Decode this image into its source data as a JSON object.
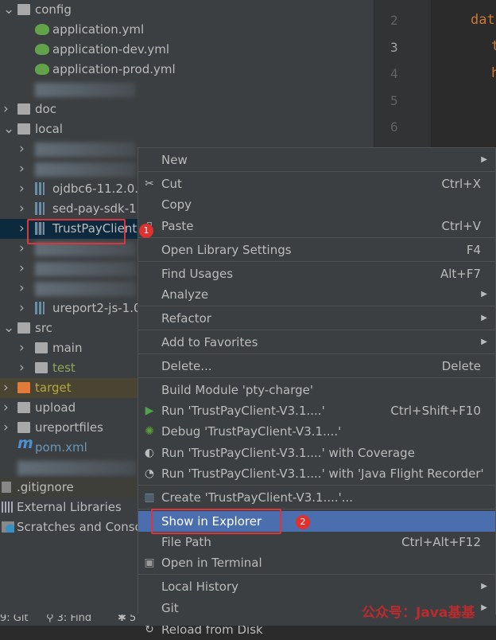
{
  "tree": [
    {
      "label": "config",
      "chevron": "down",
      "icon": "folder-config-icon",
      "level": 0
    },
    {
      "label": "application.yml",
      "icon": "spring-yml-icon",
      "level": 1
    },
    {
      "label": "application-dev.yml",
      "icon": "spring-yml-icon",
      "level": 1
    },
    {
      "label": "application-prod.yml",
      "icon": "spring-yml-icon",
      "level": 1
    },
    {
      "label": "",
      "blurred": true,
      "level": 1
    },
    {
      "label": "doc",
      "chevron": "right",
      "icon": "folder-icon",
      "level": 0
    },
    {
      "label": "local",
      "chevron": "down",
      "icon": "folder-icon",
      "level": 0
    },
    {
      "label": "",
      "blurred": true,
      "chevron": "right",
      "level": 2
    },
    {
      "label": "",
      "blurred": true,
      "chevron": "right",
      "level": 2
    },
    {
      "label": "ojdbc6-11.2.0.",
      "chevron": "right",
      "icon": "jar-icon",
      "level": 2
    },
    {
      "label": "sed-pay-sdk-1.",
      "chevron": "right",
      "icon": "jar-icon",
      "level": 2
    },
    {
      "label": "TrustPayClient",
      "chevron": "right",
      "icon": "jar-icon",
      "level": 2,
      "selected": true
    },
    {
      "label": "",
      "blurred": true,
      "chevron": "right",
      "level": 2
    },
    {
      "label": "",
      "blurred": true,
      "chevron": "right",
      "level": 2
    },
    {
      "label": "",
      "blurred": true,
      "chevron": "right",
      "level": 2
    },
    {
      "label": "ureport2-js-1.0",
      "chevron": "right",
      "icon": "jar-icon",
      "level": 2
    },
    {
      "label": "src",
      "chevron": "down",
      "icon": "folder-icon",
      "level": 0
    },
    {
      "label": "main",
      "chevron": "right",
      "icon": "folder-icon",
      "level": 2
    },
    {
      "label": "test",
      "chevron": "right",
      "icon": "folder-icon",
      "level": 2,
      "color": "#8fa656"
    },
    {
      "label": "target",
      "chevron": "right",
      "icon": "folder-excluded-icon",
      "level": 0,
      "color": "#b5a642"
    },
    {
      "label": "upload",
      "chevron": "right",
      "icon": "folder-config-icon",
      "level": 0
    },
    {
      "label": "ureportfiles",
      "chevron": "right",
      "icon": "folder-config-icon",
      "level": 0
    },
    {
      "label": "pom.xml",
      "icon": "maven-icon",
      "level": 0,
      "color": "#6897bb"
    },
    {
      "label": "",
      "blurred": true,
      "level": 0
    },
    {
      "label": ".gitignore",
      "icon": "ignore-file-icon",
      "level": -1
    },
    {
      "label": "External Libraries",
      "icon": "libraries-icon",
      "level": -1
    },
    {
      "label": "Scratches and Conso",
      "icon": "scratches-icon",
      "level": -1
    }
  ],
  "gutter": {
    "line_numbers": [
      "2",
      "3",
      "4",
      "5",
      "6"
    ],
    "current_line": "3"
  },
  "editor": {
    "snippets": [
      "dat",
      "t",
      "h"
    ]
  },
  "menu": {
    "items": [
      {
        "label": "New",
        "submenu": true
      },
      {
        "label": "Cut",
        "shortcut": "Ctrl+X",
        "icon": "scissors-icon",
        "sep_before": true
      },
      {
        "label": "Copy"
      },
      {
        "label": "Paste",
        "shortcut": "Ctrl+V",
        "icon": "clipboard-icon"
      },
      {
        "label": "Open Library Settings",
        "shortcut": "F4",
        "sep_before": true
      },
      {
        "label": "Find Usages",
        "shortcut": "Alt+F7",
        "sep_before": true
      },
      {
        "label": "Analyze",
        "submenu": true
      },
      {
        "label": "Refactor",
        "submenu": true,
        "sep_before": true
      },
      {
        "label": "Add to Favorites",
        "submenu": true,
        "sep_before": true
      },
      {
        "label": "Delete...",
        "shortcut": "Delete",
        "sep_before": true
      },
      {
        "label": "Build Module 'pty-charge'",
        "sep_before": true
      },
      {
        "label": "Run 'TrustPayClient-V3.1....'",
        "shortcut": "Ctrl+Shift+F10",
        "icon": "run-icon"
      },
      {
        "label": "Debug 'TrustPayClient-V3.1....'",
        "icon": "debug-icon"
      },
      {
        "label": "Run 'TrustPayClient-V3.1....' with Coverage",
        "icon": "coverage-icon"
      },
      {
        "label": "Run 'TrustPayClient-V3.1....' with 'Java Flight Recorder'",
        "icon": "profiler-icon"
      },
      {
        "label": "Create 'TrustPayClient-V3.1....'...",
        "icon": "run-config-icon",
        "sep_before": true
      },
      {
        "label": "Show in Explorer",
        "highlighted": true,
        "sep_before": true
      },
      {
        "label": "File Path",
        "shortcut": "Ctrl+Alt+F12"
      },
      {
        "label": "Open in Terminal",
        "icon": "terminal-icon"
      },
      {
        "label": "Local History",
        "submenu": true,
        "sep_before": true
      },
      {
        "label": "Git",
        "submenu": true
      },
      {
        "label": "Reload from Disk",
        "icon": "reload-icon"
      }
    ]
  },
  "annotations": {
    "step1": "1",
    "step2": "2"
  },
  "status_bar": {
    "git": "9: Git",
    "find": "3: Find",
    "other": "5"
  },
  "watermark": "公众号：Java基基"
}
